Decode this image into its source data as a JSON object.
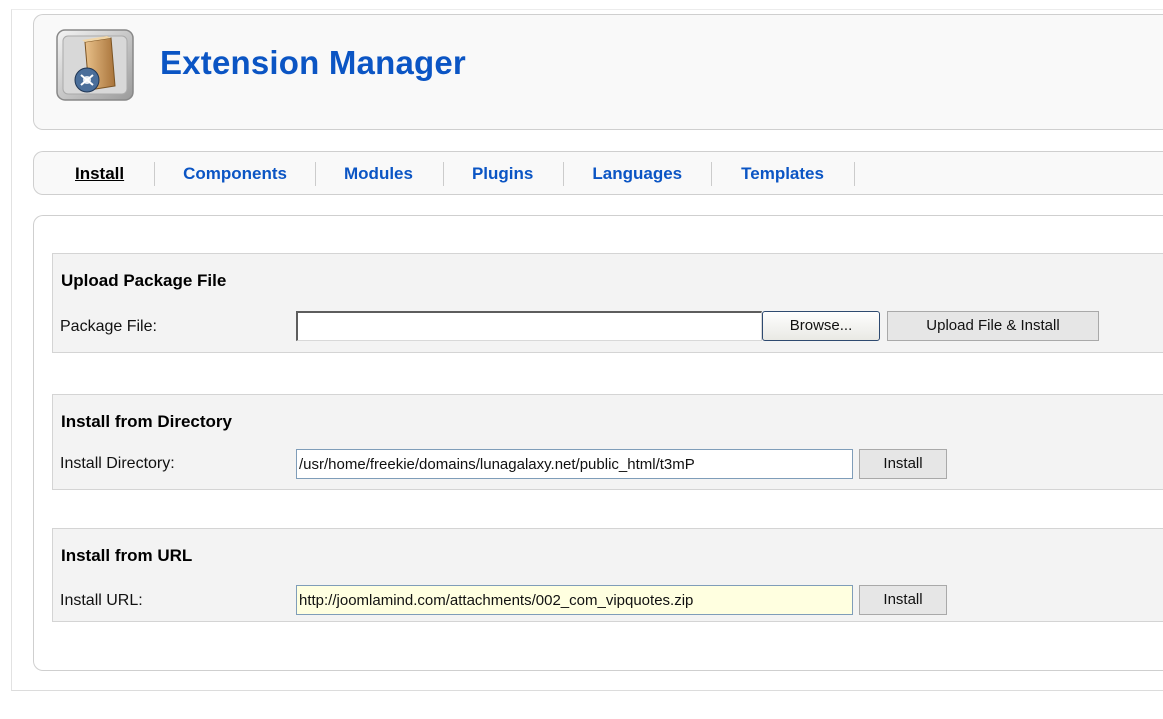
{
  "header": {
    "title": "Extension Manager",
    "icon": "package-install-icon"
  },
  "tabs": [
    {
      "label": "Install",
      "active": true
    },
    {
      "label": "Components",
      "active": false
    },
    {
      "label": "Modules",
      "active": false
    },
    {
      "label": "Plugins",
      "active": false
    },
    {
      "label": "Languages",
      "active": false
    },
    {
      "label": "Templates",
      "active": false
    }
  ],
  "upload": {
    "title": "Upload Package File",
    "label": "Package File:",
    "value": "",
    "browse_label": "Browse...",
    "submit_label": "Upload File & Install"
  },
  "directory": {
    "title": "Install from Directory",
    "label": "Install Directory:",
    "value": "/usr/home/freekie/domains/lunagalaxy.net/public_html/t3mP",
    "submit_label": "Install"
  },
  "url": {
    "title": "Install from URL",
    "label": "Install URL:",
    "value": "http://joomlamind.com/attachments/002_com_vipquotes.zip",
    "submit_label": "Install"
  },
  "colors": {
    "link": "#0b55c4",
    "url_field_bg": "#ffffe0",
    "fieldset_bg": "#f3f3f3"
  }
}
